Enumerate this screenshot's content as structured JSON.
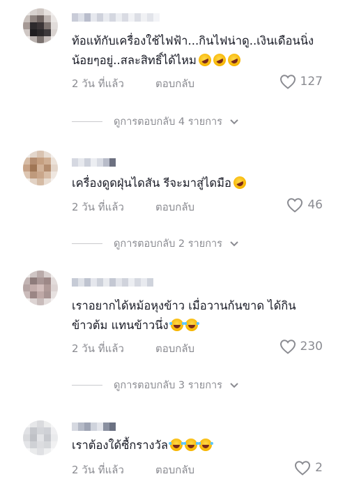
{
  "comments": [
    {
      "text_parts": [
        "ท้อแท้กับเครื่องใช้ไฟฟ้า...กินไฟน่าดู..เงินเดือนนิ่งน้อยๆอยู่..สละสิทธิ์ได้ไหม"
      ],
      "emojis": [
        "rolling-on-floor-laughing",
        "rolling-on-floor-laughing",
        "rolling-on-floor-laughing"
      ],
      "time": "2 วัน ที่แล้ว",
      "reply_label": "ตอบกลับ",
      "likes": "127",
      "view_replies": "ดูการตอบกลับ 4 รายการ"
    },
    {
      "text_parts": [
        "เครื่องดูดฝุ่นไดสัน รีจะมาสู่ไดมือ"
      ],
      "emojis": [
        "rolling-on-floor-laughing"
      ],
      "time": "2 วัน ที่แล้ว",
      "reply_label": "ตอบกลับ",
      "likes": "46",
      "view_replies": "ดูการตอบกลับ 2 รายการ"
    },
    {
      "text_parts": [
        "เราอยากได้หม้อหุงข้าว เมื่อวานก้นขาด ได้กินข้าวต้ม แทนข้าวนึ่ง"
      ],
      "emojis": [
        "face-with-tears-of-joy",
        "face-with-tears-of-joy"
      ],
      "time": "2 วัน ที่แล้ว",
      "reply_label": "ตอบกลับ",
      "likes": "230",
      "view_replies": "ดูการตอบกลับ 3 รายการ"
    },
    {
      "text_parts": [
        "เราต้องใด้ซื้กรางวัล"
      ],
      "emojis": [
        "face-with-tears-of-joy",
        "face-with-tears-of-joy",
        "face-with-tears-of-joy"
      ],
      "time": "2 วัน ที่แล้ว",
      "reply_label": "ตอบกลับ",
      "likes": "2"
    }
  ],
  "icons": {
    "like": "heart-outline-icon",
    "expand": "chevron-down-icon"
  },
  "colors": {
    "text": "#161823",
    "muted": "#8a8b91",
    "divider": "#c9cacd"
  }
}
